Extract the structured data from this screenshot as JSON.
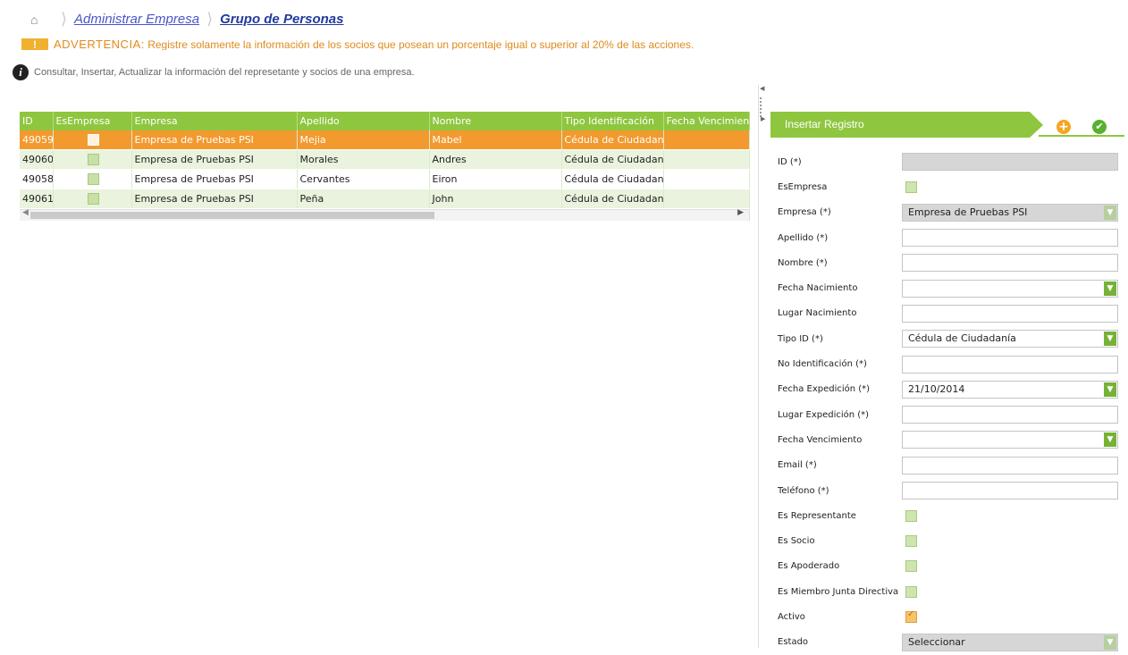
{
  "breadcrumb": {
    "items": [
      "Administrar Empresa",
      "Grupo de Personas"
    ]
  },
  "warning": {
    "label": "ADVERTENCIA:",
    "text": "Registre solamente la información de los socios que posean un porcentaje igual o superior al 20% de las acciones."
  },
  "info": {
    "text": "Consultar, Insertar, Actualizar la información del represetante y socios de una empresa."
  },
  "grid": {
    "columns": [
      "ID",
      "EsEmpresa",
      "Empresa",
      "Apellido",
      "Nombre",
      "Tipo Identificación",
      "Fecha Vencimiento"
    ],
    "rows": [
      {
        "id": "49059",
        "empresa": "Empresa de Pruebas PSI",
        "apellido": "Mejia",
        "nombre": "Mabel",
        "tipo": "Cédula de Ciudadanía",
        "fecha": ""
      },
      {
        "id": "49060",
        "empresa": "Empresa de Pruebas PSI",
        "apellido": "Morales",
        "nombre": "Andres",
        "tipo": "Cédula de Ciudadanía",
        "fecha": ""
      },
      {
        "id": "49058",
        "empresa": "Empresa de Pruebas PSI",
        "apellido": "Cervantes",
        "nombre": "Eiron",
        "tipo": "Cédula de Ciudadanía",
        "fecha": ""
      },
      {
        "id": "49061",
        "empresa": "Empresa de Pruebas PSI",
        "apellido": "Peña",
        "nombre": "John",
        "tipo": "Cédula de Ciudadanía",
        "fecha": ""
      }
    ]
  },
  "panel": {
    "title": "Insertar Registro",
    "fields": {
      "id": {
        "label": "ID (*)",
        "value": ""
      },
      "esempresa": {
        "label": "EsEmpresa"
      },
      "empresa": {
        "label": "Empresa (*)",
        "value": "Empresa de Pruebas PSI"
      },
      "apellido": {
        "label": "Apellido (*)",
        "value": ""
      },
      "nombre": {
        "label": "Nombre (*)",
        "value": ""
      },
      "fecha_nac": {
        "label": "Fecha Nacimiento",
        "value": ""
      },
      "lugar_nac": {
        "label": "Lugar Nacimiento",
        "value": ""
      },
      "tipo_id": {
        "label": "Tipo ID (*)",
        "value": "Cédula de Ciudadanía"
      },
      "no_id": {
        "label": "No Identificación (*)",
        "value": ""
      },
      "fecha_exp": {
        "label": "Fecha Expedición (*)",
        "value": "21/10/2014"
      },
      "lugar_exp": {
        "label": "Lugar Expedición (*)",
        "value": ""
      },
      "fecha_venc": {
        "label": "Fecha Vencimiento",
        "value": ""
      },
      "email": {
        "label": "Email (*)",
        "value": ""
      },
      "telefono": {
        "label": "Teléfono (*)",
        "value": ""
      },
      "representante": {
        "label": "Es Representante",
        "checked": false
      },
      "socio": {
        "label": "Es Socio",
        "checked": false
      },
      "apoderado": {
        "label": "Es Apoderado",
        "checked": false
      },
      "junta": {
        "label": "Es Miembro Junta Directiva",
        "checked": false
      },
      "activo": {
        "label": "Activo",
        "checked": true
      },
      "estado": {
        "label": "Estado",
        "value": "Seleccionar"
      }
    }
  }
}
